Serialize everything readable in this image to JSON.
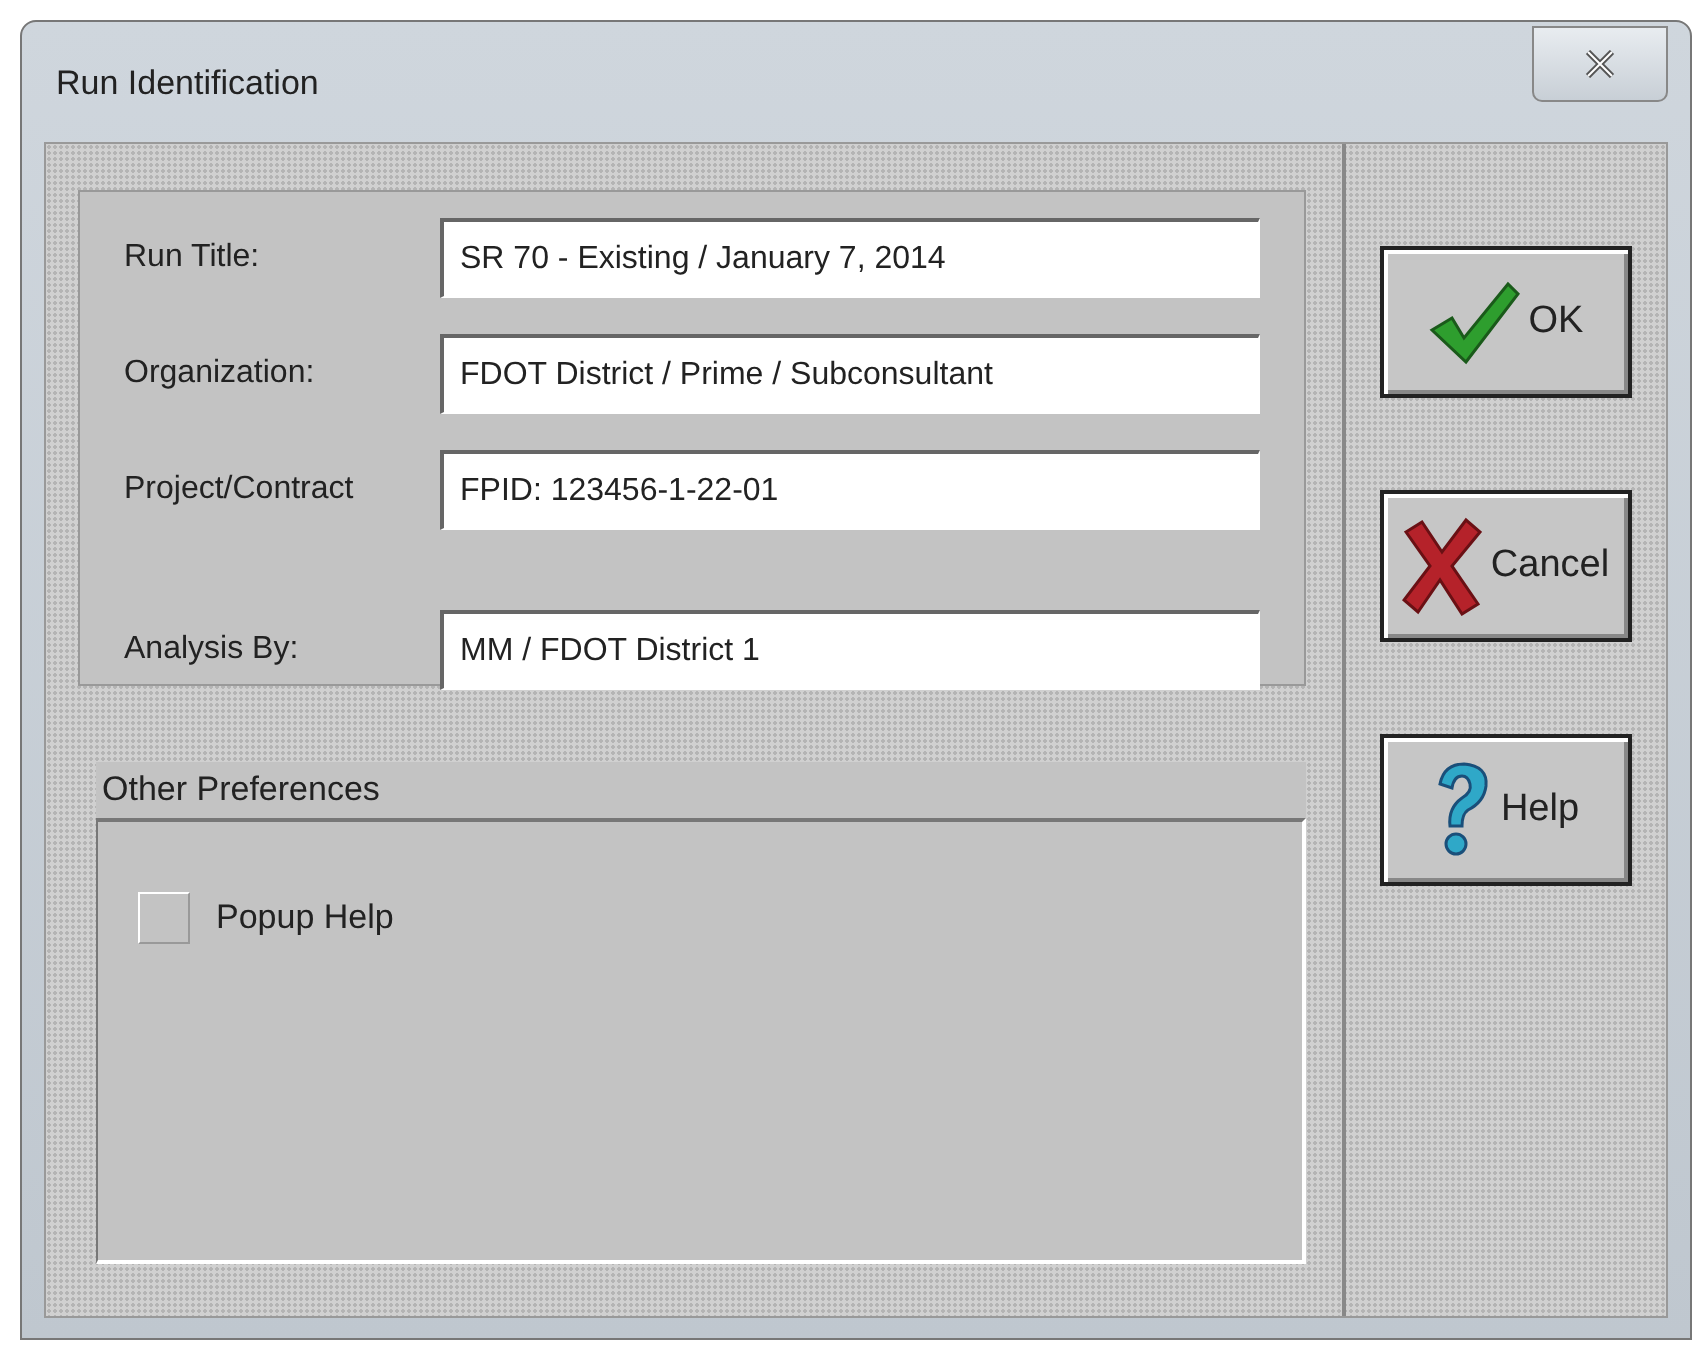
{
  "window": {
    "title": "Run Identification"
  },
  "fields": [
    {
      "label": "Run Title:",
      "value": "SR 70 - Existing / January 7, 2014"
    },
    {
      "label": "Organization:",
      "value": "FDOT District / Prime / Subconsultant"
    },
    {
      "label": "Project/Contract",
      "value": "FPID: 123456-1-22-01"
    },
    {
      "label": "Analysis By:",
      "value": "MM / FDOT District 1"
    }
  ],
  "preferences": {
    "title": "Other Preferences",
    "options": [
      {
        "label": "Popup Help",
        "checked": false
      }
    ]
  },
  "buttons": [
    {
      "kind": "ok",
      "label": "OK"
    },
    {
      "kind": "cancel",
      "label": "Cancel"
    },
    {
      "kind": "help",
      "label": "Help"
    }
  ]
}
